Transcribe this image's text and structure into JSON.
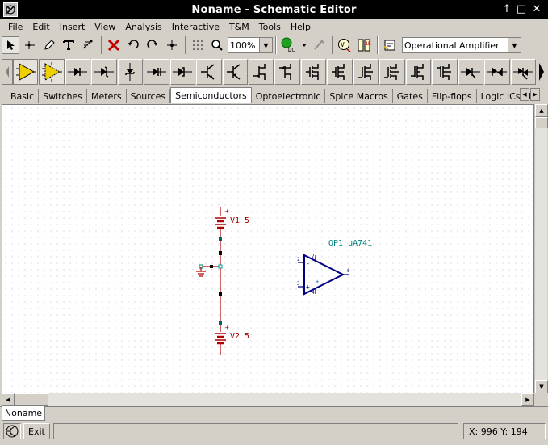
{
  "window": {
    "title": "Noname - Schematic Editor"
  },
  "menu": [
    "File",
    "Edit",
    "Insert",
    "View",
    "Analysis",
    "Interactive",
    "T&M",
    "Tools",
    "Help"
  ],
  "toolbar": {
    "zoom_value": "100%",
    "dc_label": "DC",
    "component_select": "Operational Amplifier"
  },
  "component_tabs": [
    "Basic",
    "Switches",
    "Meters",
    "Sources",
    "Semiconductors",
    "Optoelectronic",
    "Spice Macros",
    "Gates",
    "Flip-flops",
    "Logic ICs-MC"
  ],
  "active_tab": "Semiconductors",
  "schematic": {
    "v1_label": "V1 5",
    "v2_label": "V2 5",
    "opamp_label": "OP1 uA741",
    "opamp_pin_2": "2",
    "opamp_pin_3": "3",
    "opamp_pin_6": "6",
    "opamp_pin_7": "7",
    "opamp_pin_4": "4",
    "plus_sign": "+",
    "minus_sign": "-"
  },
  "document_tab": "Noname",
  "status": {
    "exit_label": "Exit",
    "coordinates": "X: 996  Y: 194"
  },
  "colors": {
    "wire": "#b00000",
    "opamp": "#000080",
    "label_red": "#a00000",
    "label_teal": "#008080"
  }
}
